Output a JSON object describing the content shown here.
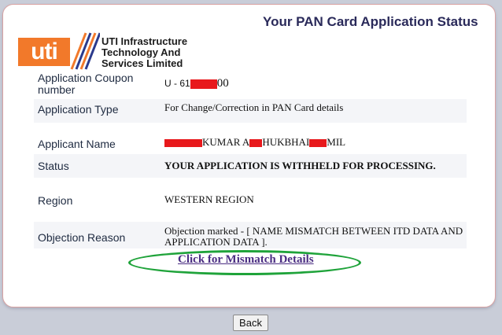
{
  "header": {
    "title": "Your PAN Card Application Status"
  },
  "logo": {
    "mark": "uti",
    "company_line1": "UTI Infrastructure",
    "company_line2": "Technology And",
    "company_line3": "Services Limited",
    "brand_color": "#f2792a"
  },
  "fields": {
    "coupon": {
      "label": "Application Coupon number",
      "value_prefix": "U - 61",
      "value_suffix": "00"
    },
    "type": {
      "label": "Application Type",
      "value": "For Change/Correction in PAN Card details"
    },
    "applicant": {
      "label": "Applicant Name",
      "value_part1": "KUMAR A",
      "value_part2": "HUKBHAI",
      "value_part3": "MIL"
    },
    "status": {
      "label": "Status",
      "value": "YOUR APPLICATION IS WITHHELD FOR PROCESSING."
    },
    "region": {
      "label": "Region",
      "value": "WESTERN REGION"
    },
    "objection": {
      "label": "Objection Reason",
      "value": "Objection marked - [ NAME MISMATCH BETWEEN ITD DATA AND APPLICATION DATA ]."
    }
  },
  "link": {
    "label": "Click for Mismatch Details",
    "highlight_color": "#1fa33a"
  },
  "actions": {
    "back_label": "Back"
  }
}
